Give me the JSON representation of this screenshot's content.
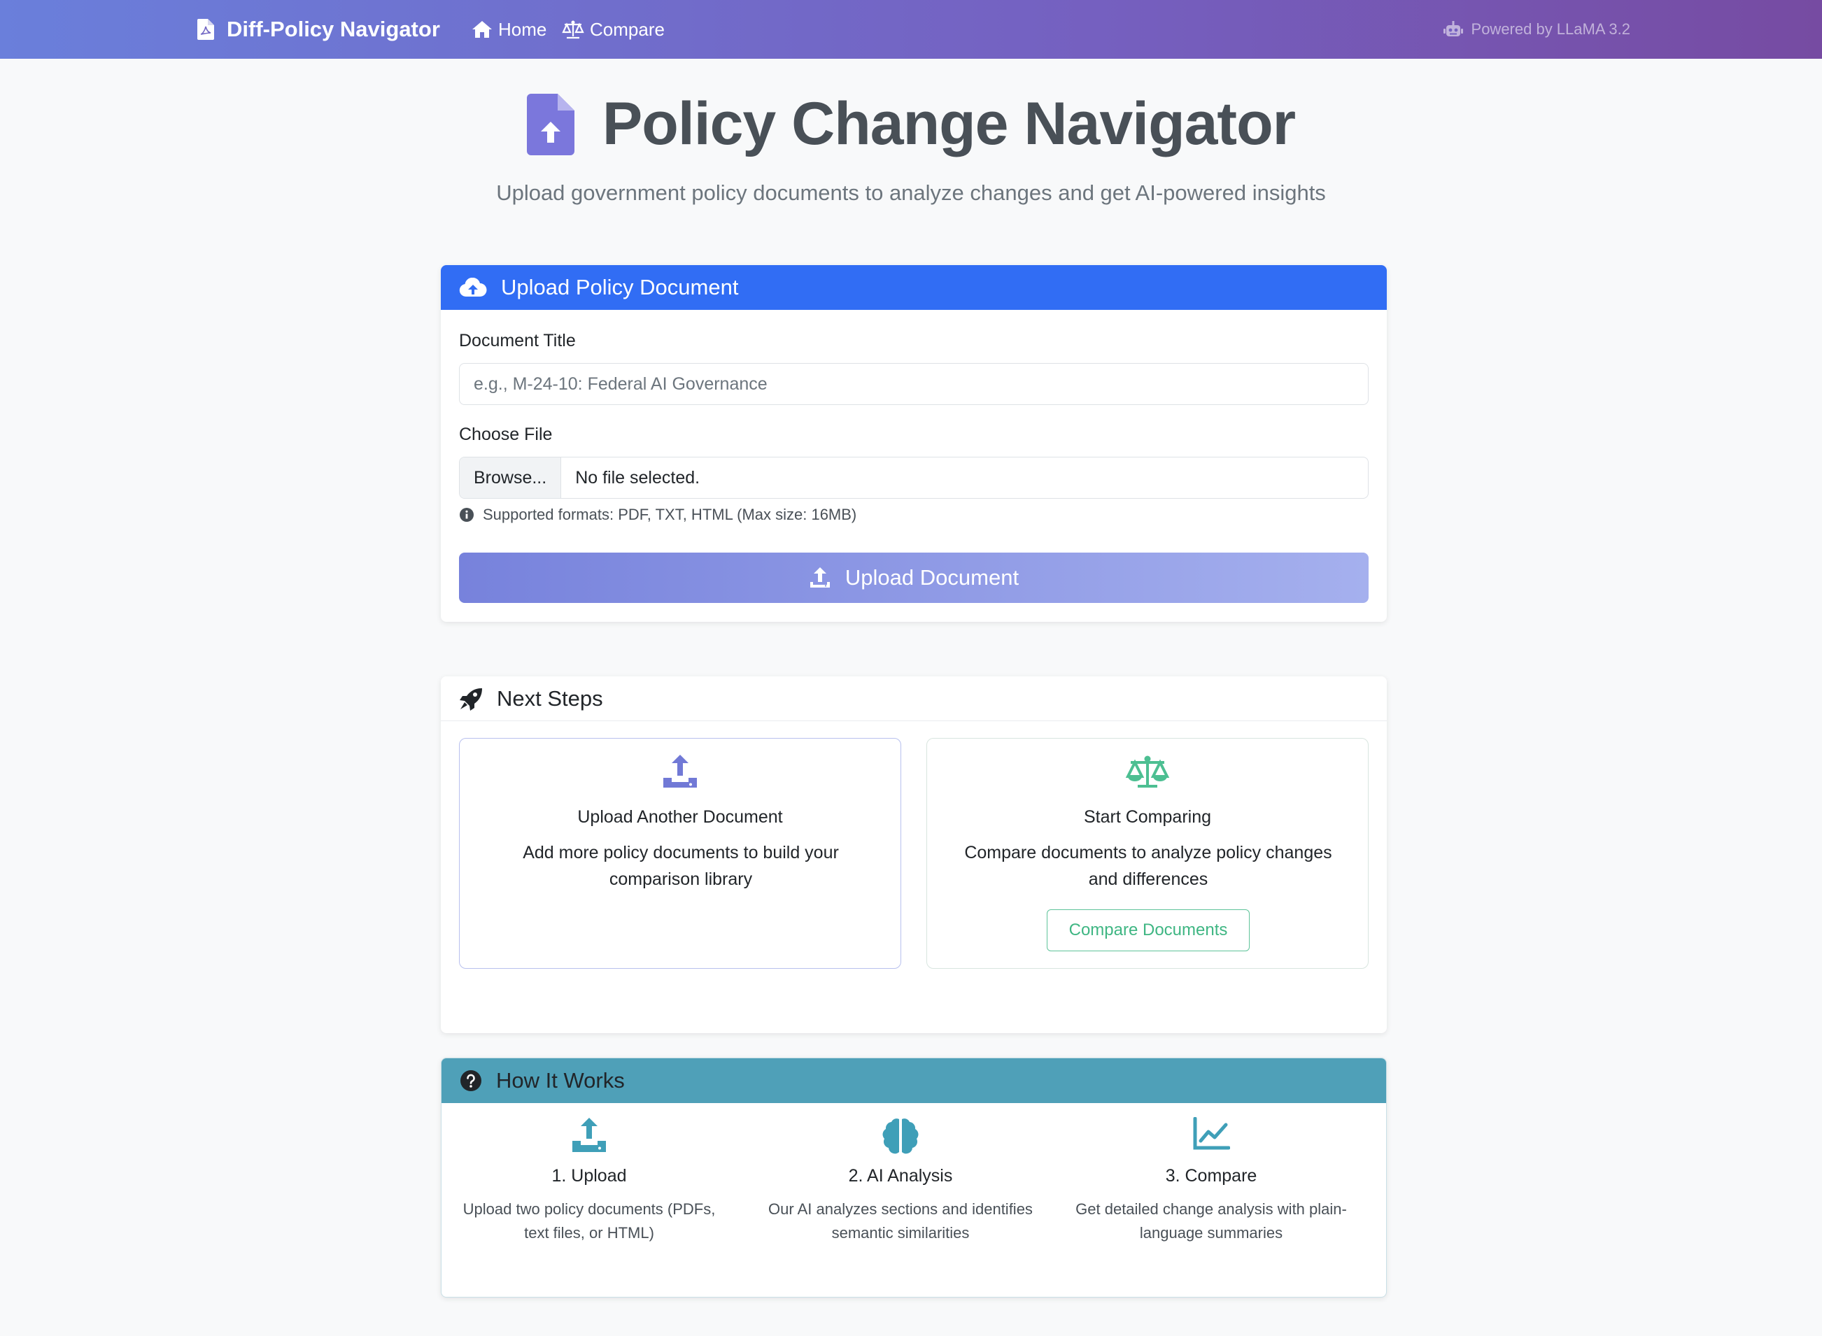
{
  "navbar": {
    "brand": "Diff-Policy Navigator",
    "links": [
      {
        "label": "Home",
        "icon": "home-icon"
      },
      {
        "label": "Compare",
        "icon": "scale-icon"
      }
    ],
    "powered_by": "Powered by LLaMA 3.2",
    "colors": {
      "gradient_start": "#6a7fdb",
      "gradient_end": "#764ba2"
    }
  },
  "hero": {
    "title": "Policy Change Navigator",
    "subtitle": "Upload government policy documents to analyze changes and get AI-powered insights",
    "icon": "file-upload-icon"
  },
  "upload": {
    "header": "Upload Policy Document",
    "title_label": "Document Title",
    "title_placeholder": "e.g., M-24-10: Federal AI Governance",
    "file_label": "Choose File",
    "browse_label": "Browse...",
    "file_status": "No file selected.",
    "help_text": "Supported formats: PDF, TXT, HTML (Max size: 16MB)",
    "button_label": "Upload Document",
    "header_color": "#316df4"
  },
  "next_steps": {
    "header": "Next Steps",
    "items": [
      {
        "title": "Upload Another Document",
        "description": "Add more policy documents to build your comparison library",
        "icon": "upload-icon"
      },
      {
        "title": "Start Comparing",
        "description": "Compare documents to analyze policy changes and differences",
        "icon": "scale-icon",
        "button": "Compare Documents"
      }
    ]
  },
  "how_it_works": {
    "header": "How It Works",
    "header_color": "#4fa0b8",
    "steps": [
      {
        "title": "1. Upload",
        "description": "Upload two policy documents (PDFs, text files, or HTML)",
        "icon": "upload-icon"
      },
      {
        "title": "2. AI Analysis",
        "description": "Our AI analyzes sections and identifies semantic similarities",
        "icon": "brain-icon"
      },
      {
        "title": "3. Compare",
        "description": "Get detailed change analysis with plain-language summaries",
        "icon": "chart-line-icon"
      }
    ]
  }
}
